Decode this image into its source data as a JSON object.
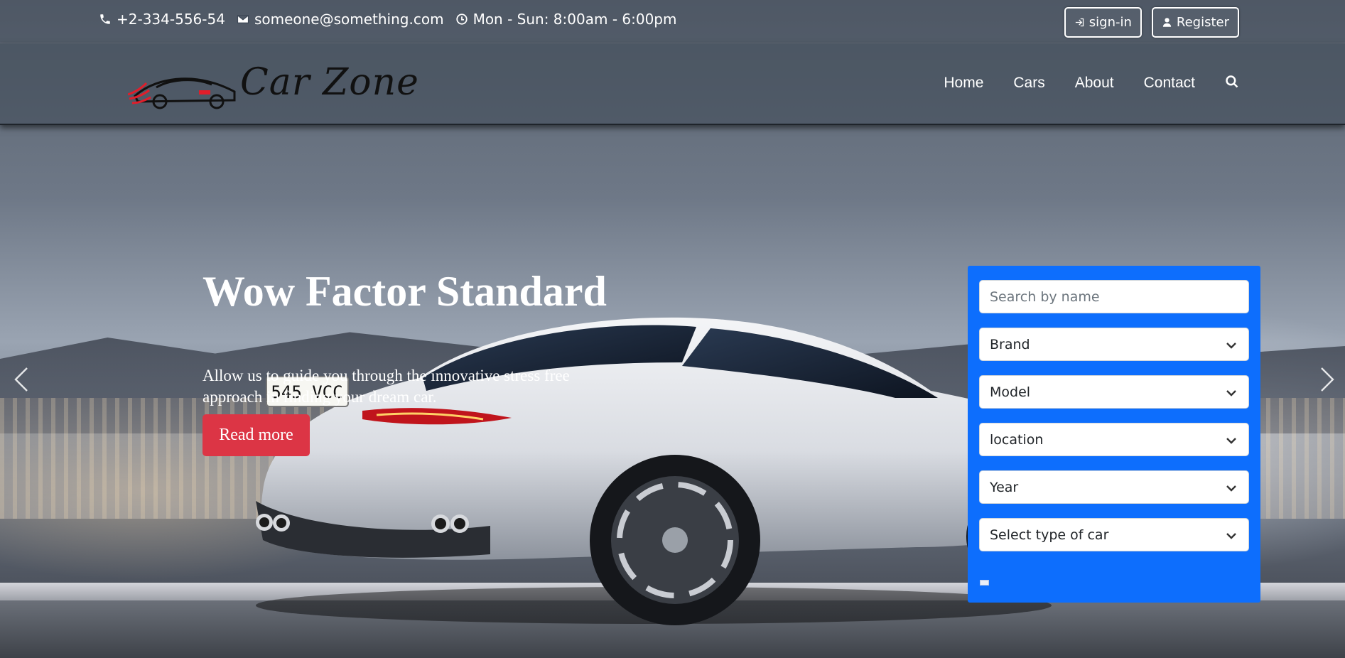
{
  "topbar": {
    "phone": "+2-334-556-54",
    "email": "someone@something.com",
    "hours": "Mon - Sun: 8:00am - 6:00pm",
    "signin_label": "sign-in",
    "register_label": "Register"
  },
  "brand": {
    "name": "Car Zone"
  },
  "nav": {
    "items": [
      {
        "label": "Home"
      },
      {
        "label": "Cars"
      },
      {
        "label": "About"
      },
      {
        "label": "Contact"
      }
    ]
  },
  "hero": {
    "title": "Wow Factor Standard",
    "description": "Allow us to guide you through the innovative stress free approach in finding your dream car.",
    "button_label": "Read more",
    "plate": "545 VCC"
  },
  "search_panel": {
    "search_placeholder": "Search by name",
    "selects": [
      {
        "value": "Brand"
      },
      {
        "value": "Model"
      },
      {
        "value": "location"
      },
      {
        "value": "Year"
      },
      {
        "value": "Select type of car"
      }
    ]
  },
  "colors": {
    "panel": "#0d6efd",
    "read_more": "#dc3545",
    "logo_accent": "#e11d2a"
  },
  "icons": {
    "phone": "phone-icon",
    "email": "envelope-icon",
    "hours": "clock-icon",
    "signin": "sign-in-icon",
    "register": "user-icon",
    "search": "search-icon",
    "prev": "chevron-left-icon",
    "next": "chevron-right-icon",
    "select": "chevron-down-icon"
  }
}
